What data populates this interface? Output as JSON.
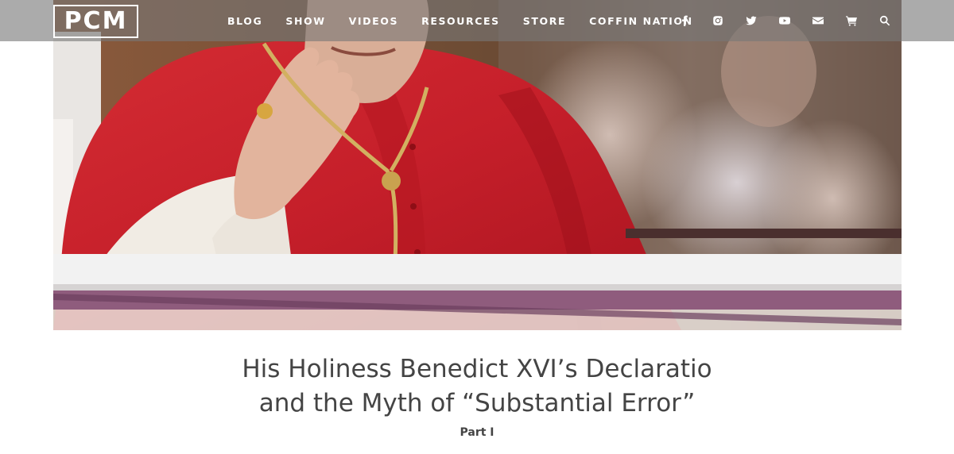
{
  "header": {
    "logo": "PCM",
    "nav": [
      {
        "label": "BLOG"
      },
      {
        "label": "SHOW"
      },
      {
        "label": "VIDEOS"
      },
      {
        "label": "RESOURCES"
      },
      {
        "label": "STORE"
      },
      {
        "label": "COFFIN NATION"
      }
    ],
    "icons": [
      "facebook-icon",
      "instagram-icon",
      "twitter-icon",
      "youtube-icon",
      "email-icon",
      "cart-icon",
      "search-icon"
    ]
  },
  "hero": {
    "description_icon": "photo-hero"
  },
  "article": {
    "title_line1": "His Holiness Benedict XVI’s Declaratio",
    "title_line2": "and the Myth of “Substantial Error”",
    "subtitle": "Part I"
  },
  "colors": {
    "navbar": "#787878",
    "title_text": "#444444",
    "robe_red": "#c8202c"
  }
}
